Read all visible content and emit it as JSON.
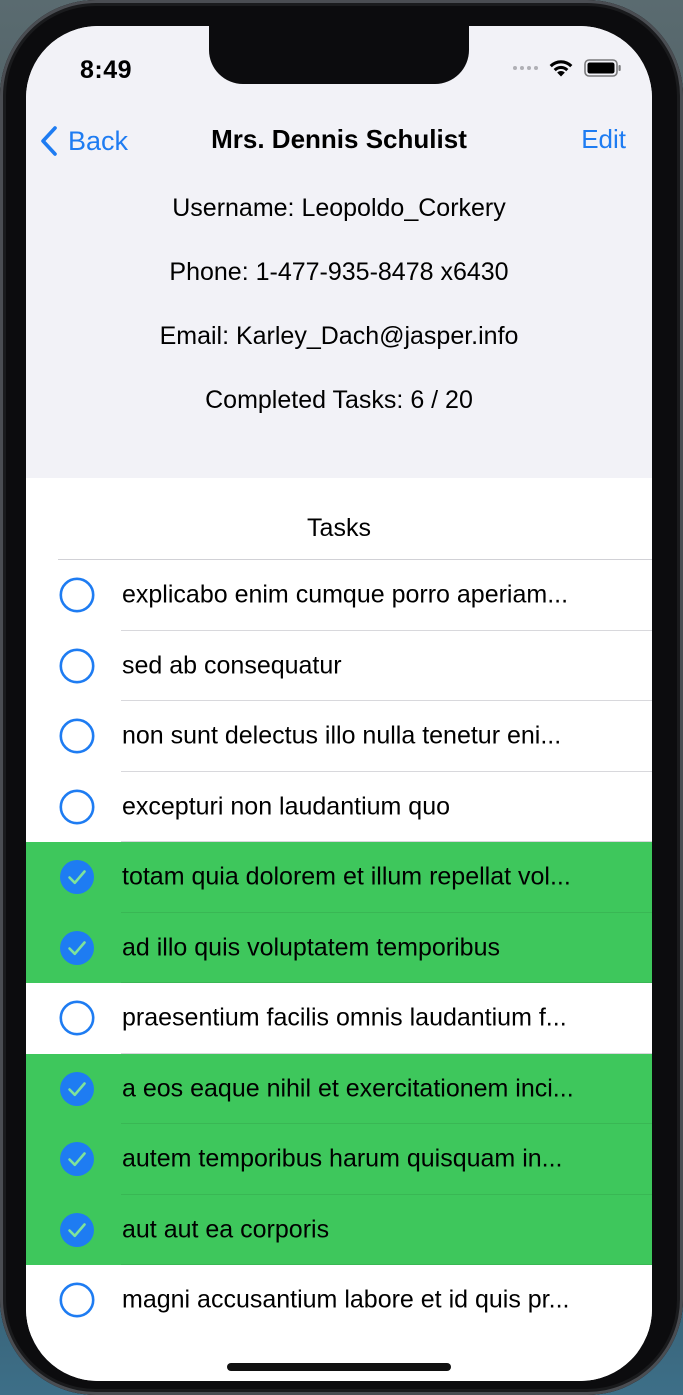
{
  "status_bar": {
    "time": "8:49"
  },
  "nav": {
    "back_label": "Back",
    "title": "Mrs. Dennis Schulist",
    "edit_label": "Edit"
  },
  "profile": {
    "username": "Username: Leopoldo_Corkery",
    "phone": "Phone: 1-477-935-8478 x6430",
    "email": "Email: Karley_Dach@jasper.info",
    "completed": "Completed Tasks: 6 / 20"
  },
  "tasks_section": {
    "title": "Tasks",
    "items": [
      {
        "text": "explicabo enim cumque porro aperiam...",
        "completed": false
      },
      {
        "text": "sed ab consequatur",
        "completed": false
      },
      {
        "text": "non sunt delectus illo nulla tenetur eni...",
        "completed": false
      },
      {
        "text": "excepturi non laudantium quo",
        "completed": false
      },
      {
        "text": "totam quia dolorem et illum repellat vol...",
        "completed": true
      },
      {
        "text": "ad illo quis voluptatem temporibus",
        "completed": true
      },
      {
        "text": "praesentium facilis omnis laudantium f...",
        "completed": false
      },
      {
        "text": "a eos eaque nihil et exercitationem inci...",
        "completed": true
      },
      {
        "text": "autem temporibus harum quisquam in...",
        "completed": true
      },
      {
        "text": "aut aut ea corporis",
        "completed": true
      },
      {
        "text": "magni accusantium labore et id quis pr...",
        "completed": false
      }
    ]
  },
  "colors": {
    "accent": "#1e7cf2",
    "completed_row": "#3ec75c",
    "header_bg": "#f2f2f7"
  }
}
